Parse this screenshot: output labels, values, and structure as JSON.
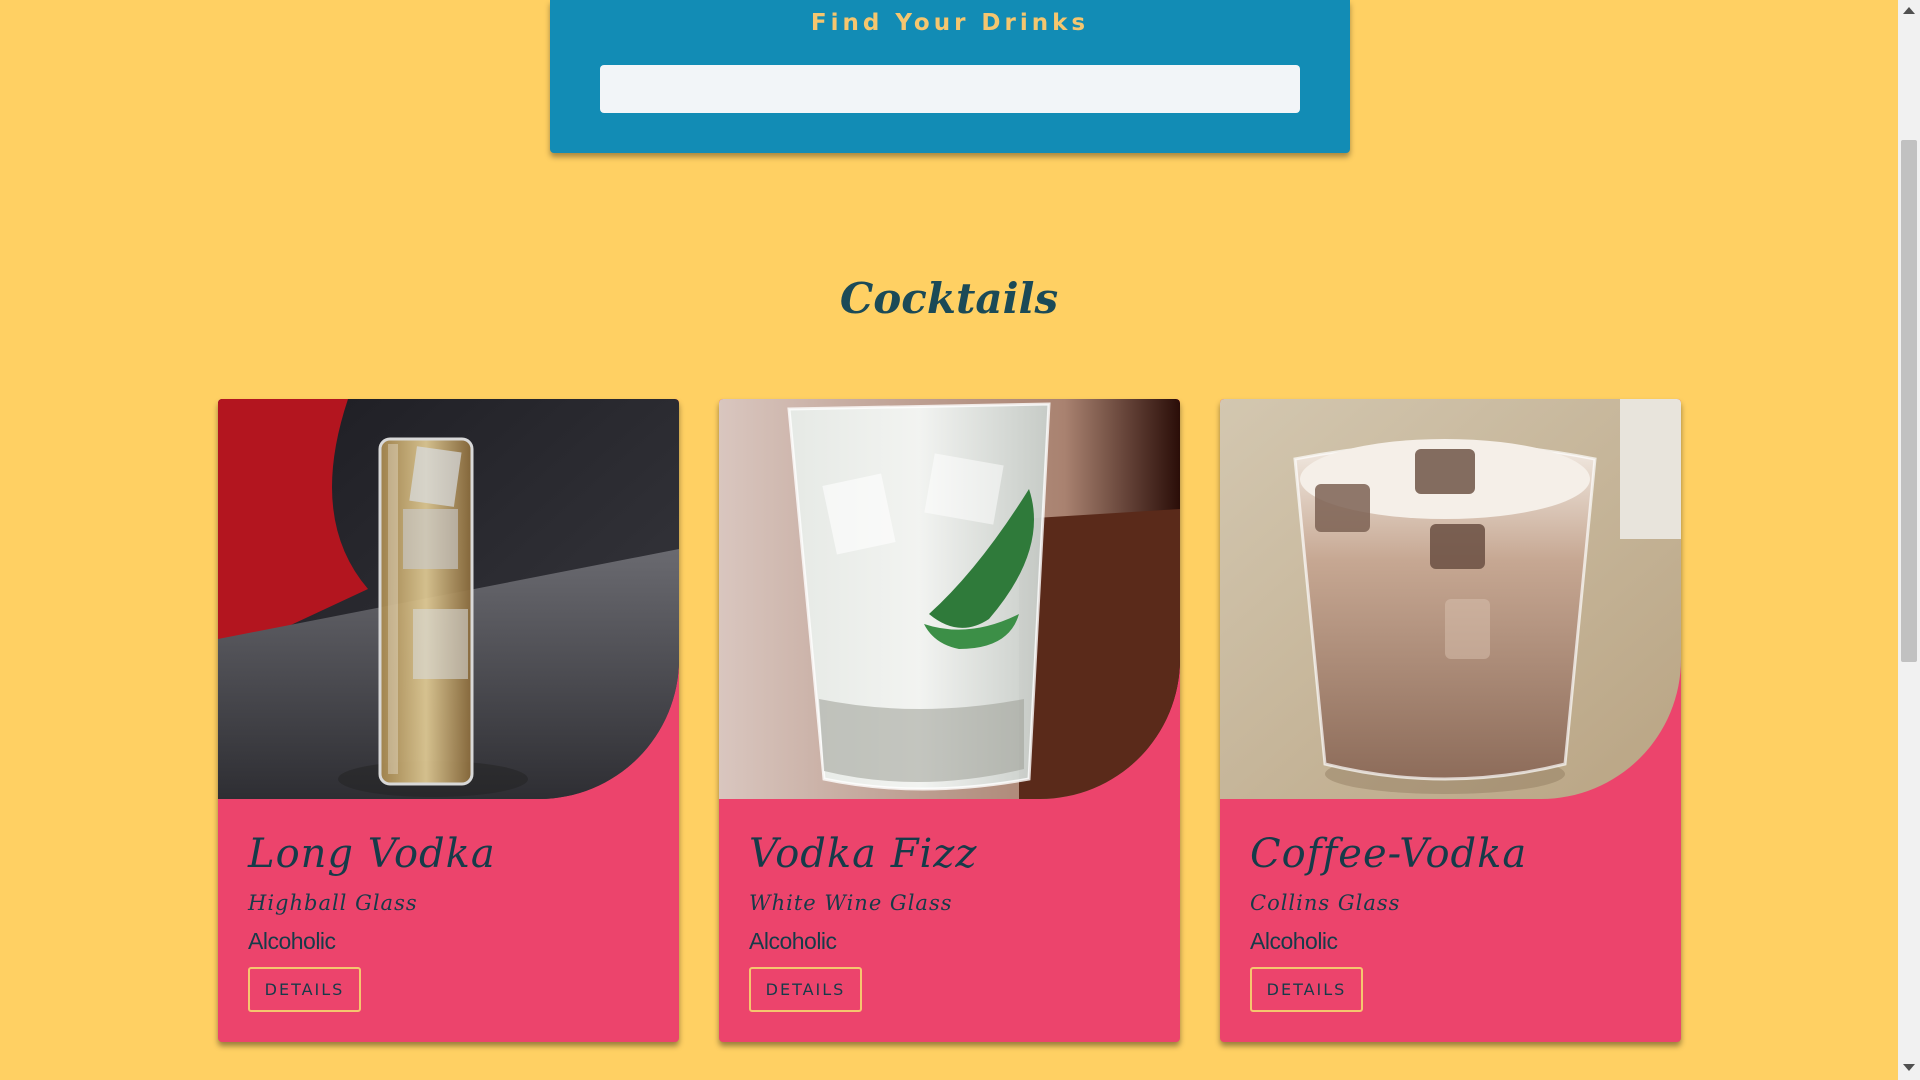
{
  "search": {
    "title": "Find Your Drinks",
    "value": "",
    "placeholder": ""
  },
  "section": {
    "title": "Cocktails"
  },
  "cards": [
    {
      "name": "Long Vodka",
      "glass": "Highball Glass",
      "type": "Alcoholic",
      "button_label": "DETAILS"
    },
    {
      "name": "Vodka Fizz",
      "glass": "White Wine Glass",
      "type": "Alcoholic",
      "button_label": "DETAILS"
    },
    {
      "name": "Coffee-Vodka",
      "glass": "Collins Glass",
      "type": "Alcoholic",
      "button_label": "DETAILS"
    }
  ],
  "colors": {
    "background": "#ffd063",
    "panel": "#128cb5",
    "card": "#ec446c",
    "accent": "#f5c66f",
    "text_dark": "#163b49"
  }
}
